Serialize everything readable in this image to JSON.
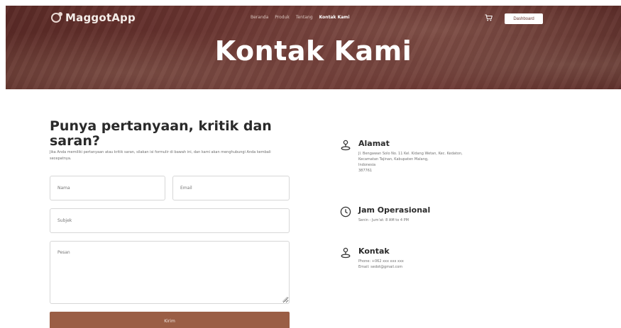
{
  "header": {
    "logo_text": "MaggotApp",
    "nav": [
      "Beranda",
      "Produk",
      "Tentang",
      "Kontak Kami"
    ],
    "nav_active_index": 3,
    "dashboard_label": "Dashboard",
    "hero_title": "Kontak Kami"
  },
  "form": {
    "heading": "Punya pertanyaan, kritik dan saran?",
    "description": "Jika Anda memiliki pertanyaan atau kritik saran, silakan isi formulir di bawah ini, dan kami akan menghubungi Anda kembali secepatnya.",
    "nama_placeholder": "Nama",
    "email_placeholder": "Email",
    "subjek_placeholder": "Subjek",
    "pesan_placeholder": "Pesan",
    "submit_label": "Kirim"
  },
  "info": {
    "alamat": {
      "title": "Alamat",
      "lines": [
        "Jl. Bengawan Solo No. 11 Kel. Kidang Wetan, Kec. Kedaton,",
        "Kecamatan Tajinan, Kabupaten Malang,",
        "Indonesia",
        "387761"
      ]
    },
    "jam": {
      "title": "Jam Operasional",
      "lines": [
        "Senin - Jum'at: 8 AM to 4 PM"
      ]
    },
    "kontak": {
      "title": "Kontak",
      "lines": [
        "Phone: +062 xxx xxx xxx",
        "Email: sedot@gmail.com"
      ]
    }
  },
  "colors": {
    "hero_bg": "#6a3531",
    "accent_button": "#9a5e45"
  },
  "icons": {
    "logo": "maggot-logo-icon",
    "cart": "cart-icon",
    "alamat": "location-person-icon",
    "jam": "clock-icon",
    "kontak": "contact-person-icon"
  }
}
